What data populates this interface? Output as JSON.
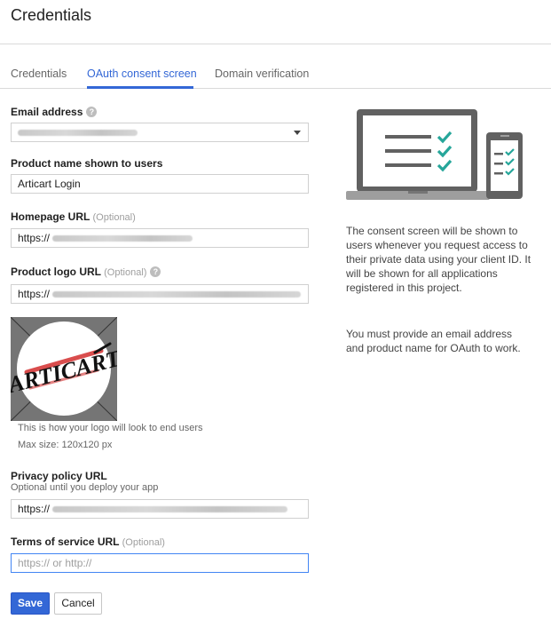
{
  "page": {
    "title": "Credentials"
  },
  "tabs": [
    {
      "label": "Credentials",
      "active": false
    },
    {
      "label": "OAuth consent screen",
      "active": true
    },
    {
      "label": "Domain verification",
      "active": false
    }
  ],
  "form": {
    "email": {
      "label": "Email address",
      "help": "?"
    },
    "product_name": {
      "label": "Product name shown to users",
      "value": "Articart Login"
    },
    "homepage": {
      "label": "Homepage URL",
      "optional": "(Optional)",
      "value_prefix": "https://"
    },
    "logo": {
      "label": "Product logo URL",
      "optional": "(Optional)",
      "help": "?",
      "value_prefix": "https://",
      "caption": "This is how your logo will look to end users",
      "max_size": "Max size: 120x120 px",
      "logo_text": "ARTICART"
    },
    "privacy": {
      "label": "Privacy policy URL",
      "note": "Optional until you deploy your app",
      "value_prefix": "https://"
    },
    "tos": {
      "label": "Terms of service URL",
      "optional": "(Optional)",
      "placeholder": "https:// or http://"
    }
  },
  "buttons": {
    "save": "Save",
    "cancel": "Cancel"
  },
  "sidebar": {
    "paragraph1": "The consent screen will be shown to users whenever you request access to their private data using your client ID. It will be shown for all applications registered in this project.",
    "paragraph2": "You must provide an email address and product name for OAuth to work."
  },
  "colors": {
    "accent": "#3367d6",
    "check": "#26a69a",
    "device": "#616161"
  }
}
